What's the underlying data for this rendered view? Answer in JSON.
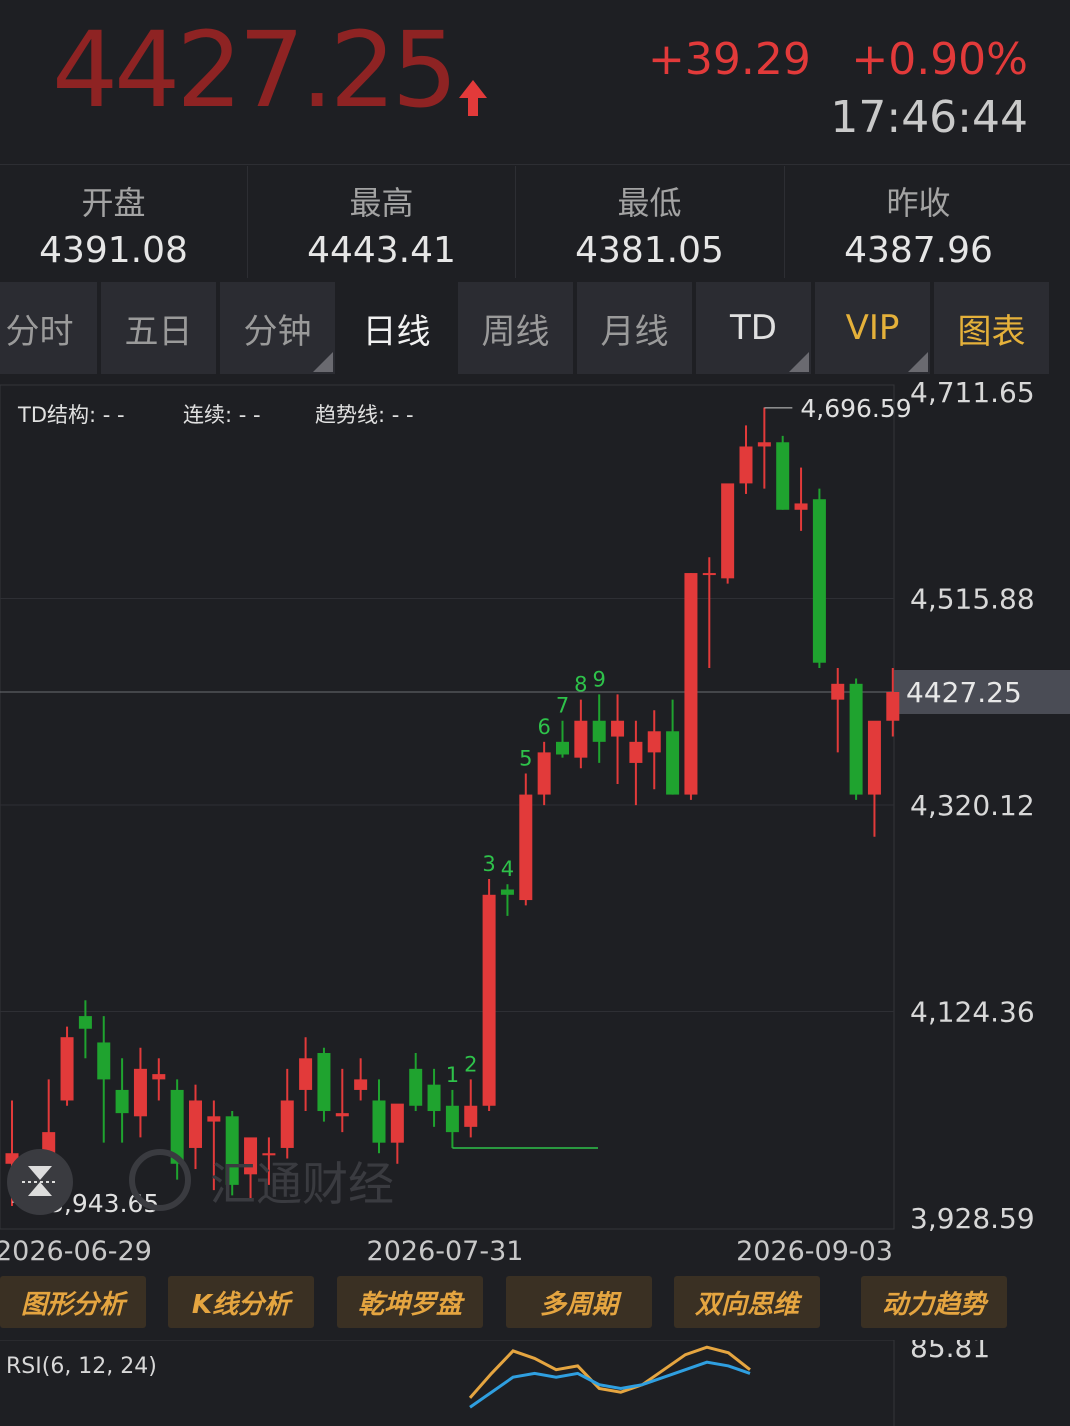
{
  "quote": {
    "price": "4427.25",
    "change": "+39.29",
    "change_pct": "+0.90%",
    "time": "17:46:44",
    "up_color": "#e23a3a",
    "down_color": "#1fa32f"
  },
  "stats": [
    {
      "label": "开盘",
      "value": "4391.08"
    },
    {
      "label": "最高",
      "value": "4443.41"
    },
    {
      "label": "最低",
      "value": "4381.05"
    },
    {
      "label": "昨收",
      "value": "4387.96"
    }
  ],
  "tabs": [
    {
      "label": "分时",
      "active": false
    },
    {
      "label": "五日",
      "active": false
    },
    {
      "label": "分钟",
      "active": false
    },
    {
      "label": "日线",
      "active": true
    },
    {
      "label": "周线",
      "active": false
    },
    {
      "label": "月线",
      "active": false
    },
    {
      "label": "TD",
      "active": false
    },
    {
      "label": "VIP",
      "active": false
    },
    {
      "label": "图表",
      "active": false
    }
  ],
  "indicators": {
    "td_structure": "TD结构: - -",
    "consecutive": "连续: - -",
    "trend_line": "趋势线: - -"
  },
  "watermark": "汇通财经",
  "buttons": [
    "图形分析",
    "K线分析",
    "乾坤罗盘",
    "多周期",
    "双向思维",
    "动力趋势"
  ],
  "rsi": {
    "label": "RSI(6, 12, 24)",
    "max_label": "85.81"
  },
  "chart_data": {
    "type": "candlestick",
    "y_ticks": [
      "4,711.65",
      "4,515.88",
      "4,320.12",
      "4,124.36",
      "3,928.59"
    ],
    "ylim": [
      3928.59,
      4711.65
    ],
    "x_labels": [
      "2026-06-29",
      "2026-07-31",
      "2026-09-03"
    ],
    "current_price_label": "4427.25",
    "current_price": 4427.25,
    "high_annotation": "4,696.59",
    "high_value": 4696.59,
    "low_annotation": "3,943.65",
    "low_value": 3943.65,
    "td_count_labels": [
      "1",
      "2",
      "3",
      "4",
      "5",
      "6",
      "7",
      "8",
      "9"
    ],
    "candles": [
      {
        "o": 3980,
        "h": 4040,
        "l": 3940,
        "c": 3990
      },
      {
        "o": 3975,
        "h": 3990,
        "l": 3944,
        "c": 3972
      },
      {
        "o": 3990,
        "h": 4060,
        "l": 3960,
        "c": 4010
      },
      {
        "o": 4040,
        "h": 4110,
        "l": 4035,
        "c": 4100
      },
      {
        "o": 4120,
        "h": 4135,
        "l": 4080,
        "c": 4108
      },
      {
        "o": 4095,
        "h": 4120,
        "l": 4000,
        "c": 4060
      },
      {
        "o": 4050,
        "h": 4080,
        "l": 4000,
        "c": 4028
      },
      {
        "o": 4025,
        "h": 4090,
        "l": 4005,
        "c": 4070
      },
      {
        "o": 4060,
        "h": 4080,
        "l": 4040,
        "c": 4065
      },
      {
        "o": 4050,
        "h": 4060,
        "l": 3965,
        "c": 3980
      },
      {
        "o": 3995,
        "h": 4055,
        "l": 3975,
        "c": 4040
      },
      {
        "o": 4020,
        "h": 4040,
        "l": 3955,
        "c": 4025
      },
      {
        "o": 4025,
        "h": 4030,
        "l": 3950,
        "c": 3960
      },
      {
        "o": 3970,
        "h": 4000,
        "l": 3945,
        "c": 4005
      },
      {
        "o": 3988,
        "h": 4005,
        "l": 3960,
        "c": 3990
      },
      {
        "o": 3995,
        "h": 4070,
        "l": 3985,
        "c": 4040
      },
      {
        "o": 4050,
        "h": 4100,
        "l": 4030,
        "c": 4080
      },
      {
        "o": 4085,
        "h": 4090,
        "l": 4020,
        "c": 4030
      },
      {
        "o": 4025,
        "h": 4070,
        "l": 4010,
        "c": 4028
      },
      {
        "o": 4050,
        "h": 4080,
        "l": 4040,
        "c": 4060
      },
      {
        "o": 4040,
        "h": 4060,
        "l": 3990,
        "c": 4000
      },
      {
        "o": 4000,
        "h": 4030,
        "l": 3980,
        "c": 4037
      },
      {
        "o": 4070,
        "h": 4085,
        "l": 4030,
        "c": 4035
      },
      {
        "o": 4055,
        "h": 4070,
        "l": 4015,
        "c": 4030
      },
      {
        "o": 4035,
        "h": 4050,
        "l": 3995,
        "c": 4010
      },
      {
        "o": 4015,
        "h": 4060,
        "l": 4005,
        "c": 4035
      },
      {
        "o": 4035,
        "h": 4250,
        "l": 4030,
        "c": 4235
      },
      {
        "o": 4240,
        "h": 4245,
        "l": 4215,
        "c": 4235
      },
      {
        "o": 4230,
        "h": 4350,
        "l": 4225,
        "c": 4330
      },
      {
        "o": 4330,
        "h": 4380,
        "l": 4320,
        "c": 4370
      },
      {
        "o": 4380,
        "h": 4400,
        "l": 4365,
        "c": 4368
      },
      {
        "o": 4365,
        "h": 4420,
        "l": 4355,
        "c": 4400
      },
      {
        "o": 4400,
        "h": 4425,
        "l": 4360,
        "c": 4380
      },
      {
        "o": 4385,
        "h": 4425,
        "l": 4340,
        "c": 4400
      },
      {
        "o": 4360,
        "h": 4400,
        "l": 4320,
        "c": 4380
      },
      {
        "o": 4370,
        "h": 4410,
        "l": 4335,
        "c": 4390
      },
      {
        "o": 4390,
        "h": 4420,
        "l": 4330,
        "c": 4330
      },
      {
        "o": 4330,
        "h": 4540,
        "l": 4325,
        "c": 4540
      },
      {
        "o": 4540,
        "h": 4555,
        "l": 4450,
        "c": 4540
      },
      {
        "o": 4535,
        "h": 4620,
        "l": 4530,
        "c": 4625
      },
      {
        "o": 4625,
        "h": 4680,
        "l": 4615,
        "c": 4660
      },
      {
        "o": 4660,
        "h": 4697,
        "l": 4620,
        "c": 4664
      },
      {
        "o": 4664,
        "h": 4670,
        "l": 4600,
        "c": 4600
      },
      {
        "o": 4600,
        "h": 4640,
        "l": 4580,
        "c": 4606
      },
      {
        "o": 4610,
        "h": 4620,
        "l": 4450,
        "c": 4455
      },
      {
        "o": 4420,
        "h": 4450,
        "l": 4370,
        "c": 4435
      },
      {
        "o": 4435,
        "h": 4440,
        "l": 4325,
        "c": 4330
      },
      {
        "o": 4330,
        "h": 4395,
        "l": 4290,
        "c": 4400
      },
      {
        "o": 4400,
        "h": 4450,
        "l": 4385,
        "c": 4427.25
      }
    ],
    "rsi_series": [
      {
        "name": "RSI6",
        "values": [
          55,
          68,
          80,
          76,
          70,
          72,
          60,
          58,
          62,
          70,
          78,
          82,
          79,
          70
        ]
      },
      {
        "name": "RSI12",
        "values": [
          50,
          58,
          66,
          68,
          66,
          68,
          62,
          60,
          62,
          66,
          70,
          74,
          72,
          68
        ]
      }
    ]
  }
}
